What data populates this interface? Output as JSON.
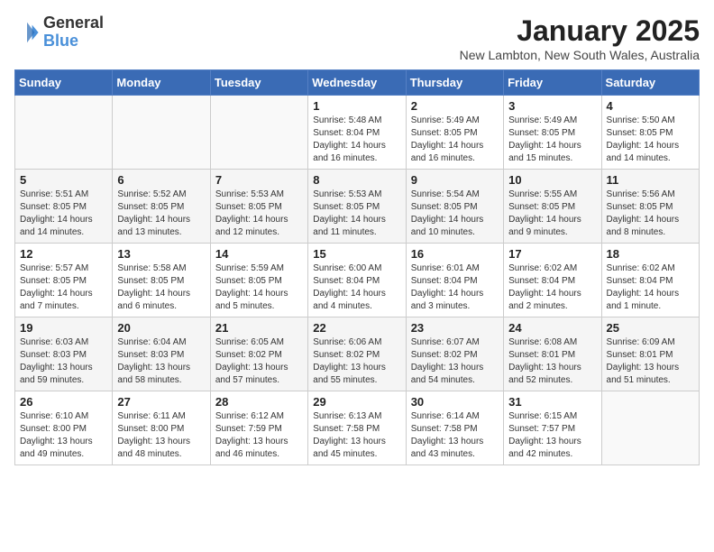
{
  "header": {
    "logo": {
      "general": "General",
      "blue": "Blue"
    },
    "title": "January 2025",
    "location": "New Lambton, New South Wales, Australia"
  },
  "days_of_week": [
    "Sunday",
    "Monday",
    "Tuesday",
    "Wednesday",
    "Thursday",
    "Friday",
    "Saturday"
  ],
  "weeks": [
    [
      {
        "day": "",
        "info": ""
      },
      {
        "day": "",
        "info": ""
      },
      {
        "day": "",
        "info": ""
      },
      {
        "day": "1",
        "info": "Sunrise: 5:48 AM\nSunset: 8:04 PM\nDaylight: 14 hours\nand 16 minutes."
      },
      {
        "day": "2",
        "info": "Sunrise: 5:49 AM\nSunset: 8:05 PM\nDaylight: 14 hours\nand 16 minutes."
      },
      {
        "day": "3",
        "info": "Sunrise: 5:49 AM\nSunset: 8:05 PM\nDaylight: 14 hours\nand 15 minutes."
      },
      {
        "day": "4",
        "info": "Sunrise: 5:50 AM\nSunset: 8:05 PM\nDaylight: 14 hours\nand 14 minutes."
      }
    ],
    [
      {
        "day": "5",
        "info": "Sunrise: 5:51 AM\nSunset: 8:05 PM\nDaylight: 14 hours\nand 14 minutes."
      },
      {
        "day": "6",
        "info": "Sunrise: 5:52 AM\nSunset: 8:05 PM\nDaylight: 14 hours\nand 13 minutes."
      },
      {
        "day": "7",
        "info": "Sunrise: 5:53 AM\nSunset: 8:05 PM\nDaylight: 14 hours\nand 12 minutes."
      },
      {
        "day": "8",
        "info": "Sunrise: 5:53 AM\nSunset: 8:05 PM\nDaylight: 14 hours\nand 11 minutes."
      },
      {
        "day": "9",
        "info": "Sunrise: 5:54 AM\nSunset: 8:05 PM\nDaylight: 14 hours\nand 10 minutes."
      },
      {
        "day": "10",
        "info": "Sunrise: 5:55 AM\nSunset: 8:05 PM\nDaylight: 14 hours\nand 9 minutes."
      },
      {
        "day": "11",
        "info": "Sunrise: 5:56 AM\nSunset: 8:05 PM\nDaylight: 14 hours\nand 8 minutes."
      }
    ],
    [
      {
        "day": "12",
        "info": "Sunrise: 5:57 AM\nSunset: 8:05 PM\nDaylight: 14 hours\nand 7 minutes."
      },
      {
        "day": "13",
        "info": "Sunrise: 5:58 AM\nSunset: 8:05 PM\nDaylight: 14 hours\nand 6 minutes."
      },
      {
        "day": "14",
        "info": "Sunrise: 5:59 AM\nSunset: 8:05 PM\nDaylight: 14 hours\nand 5 minutes."
      },
      {
        "day": "15",
        "info": "Sunrise: 6:00 AM\nSunset: 8:04 PM\nDaylight: 14 hours\nand 4 minutes."
      },
      {
        "day": "16",
        "info": "Sunrise: 6:01 AM\nSunset: 8:04 PM\nDaylight: 14 hours\nand 3 minutes."
      },
      {
        "day": "17",
        "info": "Sunrise: 6:02 AM\nSunset: 8:04 PM\nDaylight: 14 hours\nand 2 minutes."
      },
      {
        "day": "18",
        "info": "Sunrise: 6:02 AM\nSunset: 8:04 PM\nDaylight: 14 hours\nand 1 minute."
      }
    ],
    [
      {
        "day": "19",
        "info": "Sunrise: 6:03 AM\nSunset: 8:03 PM\nDaylight: 13 hours\nand 59 minutes."
      },
      {
        "day": "20",
        "info": "Sunrise: 6:04 AM\nSunset: 8:03 PM\nDaylight: 13 hours\nand 58 minutes."
      },
      {
        "day": "21",
        "info": "Sunrise: 6:05 AM\nSunset: 8:02 PM\nDaylight: 13 hours\nand 57 minutes."
      },
      {
        "day": "22",
        "info": "Sunrise: 6:06 AM\nSunset: 8:02 PM\nDaylight: 13 hours\nand 55 minutes."
      },
      {
        "day": "23",
        "info": "Sunrise: 6:07 AM\nSunset: 8:02 PM\nDaylight: 13 hours\nand 54 minutes."
      },
      {
        "day": "24",
        "info": "Sunrise: 6:08 AM\nSunset: 8:01 PM\nDaylight: 13 hours\nand 52 minutes."
      },
      {
        "day": "25",
        "info": "Sunrise: 6:09 AM\nSunset: 8:01 PM\nDaylight: 13 hours\nand 51 minutes."
      }
    ],
    [
      {
        "day": "26",
        "info": "Sunrise: 6:10 AM\nSunset: 8:00 PM\nDaylight: 13 hours\nand 49 minutes."
      },
      {
        "day": "27",
        "info": "Sunrise: 6:11 AM\nSunset: 8:00 PM\nDaylight: 13 hours\nand 48 minutes."
      },
      {
        "day": "28",
        "info": "Sunrise: 6:12 AM\nSunset: 7:59 PM\nDaylight: 13 hours\nand 46 minutes."
      },
      {
        "day": "29",
        "info": "Sunrise: 6:13 AM\nSunset: 7:58 PM\nDaylight: 13 hours\nand 45 minutes."
      },
      {
        "day": "30",
        "info": "Sunrise: 6:14 AM\nSunset: 7:58 PM\nDaylight: 13 hours\nand 43 minutes."
      },
      {
        "day": "31",
        "info": "Sunrise: 6:15 AM\nSunset: 7:57 PM\nDaylight: 13 hours\nand 42 minutes."
      },
      {
        "day": "",
        "info": ""
      }
    ]
  ]
}
